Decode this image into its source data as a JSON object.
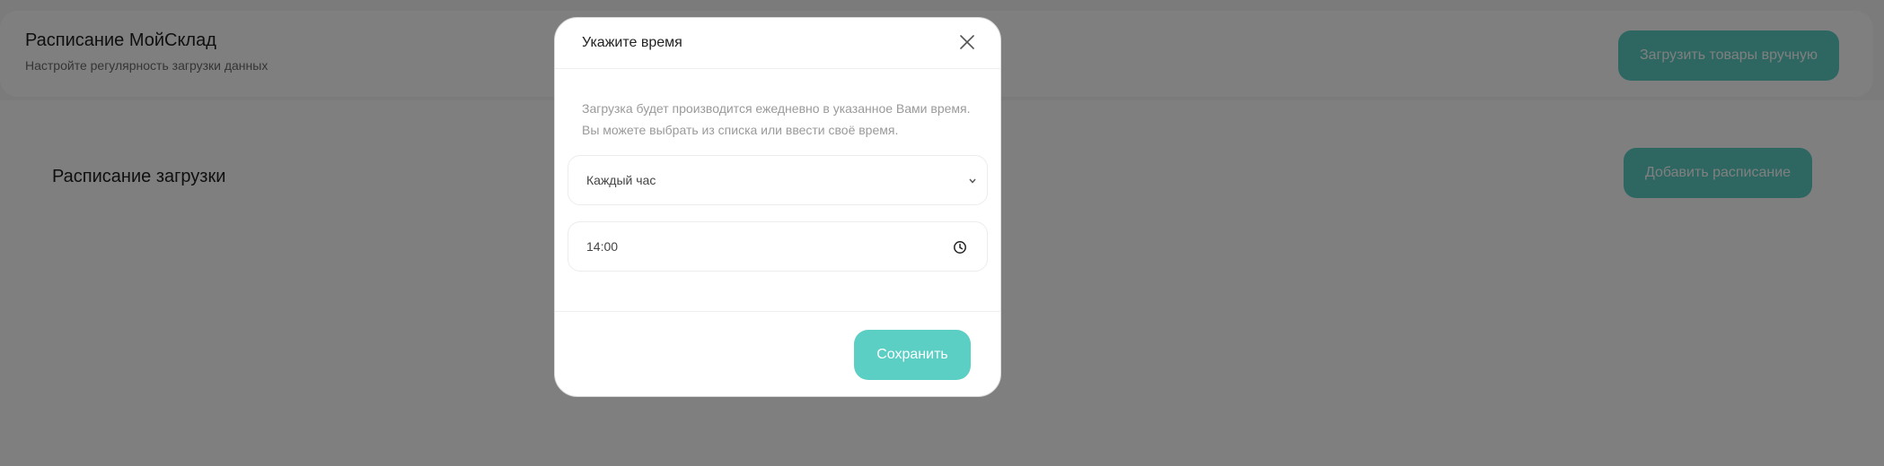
{
  "header": {
    "title": "Расписание МойСклад",
    "subtitle": "Настройте регулярность загрузки данных",
    "load_button": "Загрузить товары вручную"
  },
  "section": {
    "title": "Расписание загрузки",
    "add_button": "Добавить расписание"
  },
  "modal": {
    "title": "Укажите время",
    "description_line1": "Загрузка будет производится ежедневно в указанное Вами время.",
    "description_line2": "Вы можете выбрать из списка или ввести своё время.",
    "frequency_value": "Каждый час",
    "time_value": "14:00",
    "save_button": "Сохранить"
  },
  "icons": {
    "close": "close-icon",
    "dropdown": "chevron-down-icon",
    "clock": "clock-icon"
  },
  "colors": {
    "accent": "#5ccfc5",
    "overlay": "rgba(0,0,0,0.5)"
  }
}
